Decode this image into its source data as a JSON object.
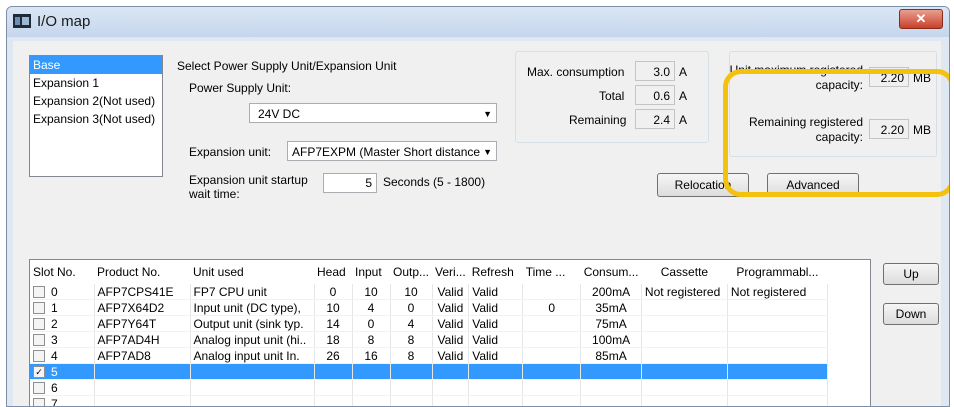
{
  "window": {
    "title": "I/O map",
    "close": "✕"
  },
  "unit_list": [
    "Base",
    "Expansion 1",
    "Expansion 2(Not used)",
    "Expansion 3(Not used)"
  ],
  "power": {
    "section_label": "Select Power Supply Unit/Expansion Unit",
    "psu_label": "Power Supply Unit:",
    "psu_value": "24V DC",
    "exp_label": "Expansion unit:",
    "exp_value": "AFP7EXPM (Master Short distance",
    "startup_label_1": "Expansion unit startup",
    "startup_label_2": "wait time:",
    "startup_value": "5",
    "startup_range": "Seconds (5 - 1800)"
  },
  "consumption": {
    "max_label": "Max. consumption",
    "max_value": "3.0",
    "max_unit": "A",
    "total_label": "Total",
    "total_value": "0.6",
    "total_unit": "A",
    "remaining_label": "Remaining",
    "remaining_value": "2.4",
    "remaining_unit": "A"
  },
  "capacity": {
    "unit_max_label_1": "Unit maximum registered",
    "unit_max_label_2": "capacity:",
    "unit_max_value": "2.20",
    "unit_max_unit": "MB",
    "remaining_label_1": "Remaining registered",
    "remaining_label_2": "capacity:",
    "remaining_value": "2.20",
    "remaining_unit": "MB"
  },
  "buttons": {
    "relocation": "Relocation",
    "advanced": "Advanced",
    "up": "Up",
    "down": "Down"
  },
  "table": {
    "headers": [
      "Slot No.",
      "Product No.",
      "Unit used",
      "Head",
      "Input",
      "Outp...",
      "Veri...",
      "Refresh",
      "Time ...",
      "Consum...",
      "Cassette",
      "Programmabl..."
    ],
    "rows": [
      {
        "checked": false,
        "slot": "0",
        "product": "AFP7CPS41E",
        "unit": "FP7 CPU unit",
        "head": "0",
        "input": "10",
        "output": "10",
        "verify": "Valid",
        "refresh": "Valid",
        "time": "",
        "consum": "200mA",
        "cassette": "Not registered",
        "prog": "Not registered"
      },
      {
        "checked": false,
        "slot": "1",
        "product": "AFP7X64D2",
        "unit": "Input unit (DC type),",
        "head": "10",
        "input": "4",
        "output": "0",
        "verify": "Valid",
        "refresh": "Valid",
        "time": "0",
        "consum": "35mA",
        "cassette": "",
        "prog": ""
      },
      {
        "checked": false,
        "slot": "2",
        "product": "AFP7Y64T",
        "unit": "Output unit (sink typ.",
        "head": "14",
        "input": "0",
        "output": "4",
        "verify": "Valid",
        "refresh": "Valid",
        "time": "",
        "consum": "75mA",
        "cassette": "",
        "prog": ""
      },
      {
        "checked": false,
        "slot": "3",
        "product": "AFP7AD4H",
        "unit": "Analog input unit (hi..",
        "head": "18",
        "input": "8",
        "output": "8",
        "verify": "Valid",
        "refresh": "Valid",
        "time": "",
        "consum": "100mA",
        "cassette": "",
        "prog": ""
      },
      {
        "checked": false,
        "slot": "4",
        "product": "AFP7AD8",
        "unit": "Analog input unit In.",
        "head": "26",
        "input": "16",
        "output": "8",
        "verify": "Valid",
        "refresh": "Valid",
        "time": "",
        "consum": "85mA",
        "cassette": "",
        "prog": ""
      },
      {
        "checked": true,
        "slot": "5",
        "product": "",
        "unit": "",
        "head": "",
        "input": "",
        "output": "",
        "verify": "",
        "refresh": "",
        "time": "",
        "consum": "",
        "cassette": "",
        "prog": ""
      },
      {
        "checked": false,
        "slot": "6",
        "product": "",
        "unit": "",
        "head": "",
        "input": "",
        "output": "",
        "verify": "",
        "refresh": "",
        "time": "",
        "consum": "",
        "cassette": "",
        "prog": ""
      },
      {
        "checked": false,
        "slot": "7",
        "product": "",
        "unit": "",
        "head": "",
        "input": "",
        "output": "",
        "verify": "",
        "refresh": "",
        "time": "",
        "consum": "",
        "cassette": "",
        "prog": ""
      }
    ]
  },
  "colors": {
    "selection": "#3399ff",
    "highlight": "#f4c20d",
    "close": "#c9402a"
  }
}
